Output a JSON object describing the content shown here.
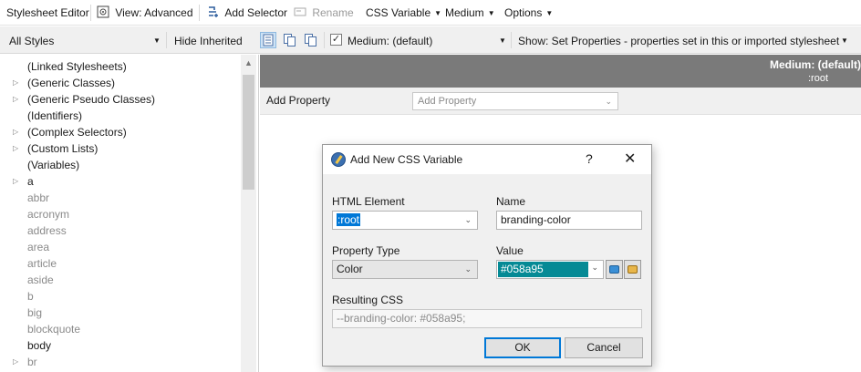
{
  "toolbar": {
    "title": "Stylesheet Editor",
    "view": "View: Advanced",
    "add_selector": "Add Selector",
    "rename": "Rename",
    "css_variable": "CSS Variable",
    "medium": "Medium",
    "options": "Options"
  },
  "filterbar": {
    "styles_select": "All Styles",
    "hide_inherited": "Hide Inherited",
    "medium_checked": true,
    "medium_select": "Medium: (default)",
    "show_select": "Show: Set Properties - properties set in this or imported stylesheet"
  },
  "tree": {
    "items": [
      {
        "label": "(Linked Stylesheets)",
        "expandable": false,
        "style": "normal"
      },
      {
        "label": "(Generic Classes)",
        "expandable": true,
        "style": "normal"
      },
      {
        "label": "(Generic Pseudo Classes)",
        "expandable": true,
        "style": "normal"
      },
      {
        "label": "(Identifiers)",
        "expandable": false,
        "style": "normal"
      },
      {
        "label": "(Complex Selectors)",
        "expandable": true,
        "style": "normal"
      },
      {
        "label": "(Custom Lists)",
        "expandable": true,
        "style": "normal"
      },
      {
        "label": "(Variables)",
        "expandable": false,
        "style": "normal"
      },
      {
        "label": "a",
        "expandable": true,
        "style": "normal"
      },
      {
        "label": "abbr",
        "expandable": false,
        "style": "grey"
      },
      {
        "label": "acronym",
        "expandable": false,
        "style": "grey"
      },
      {
        "label": "address",
        "expandable": false,
        "style": "grey"
      },
      {
        "label": "area",
        "expandable": false,
        "style": "grey"
      },
      {
        "label": "article",
        "expandable": false,
        "style": "grey"
      },
      {
        "label": "aside",
        "expandable": false,
        "style": "grey"
      },
      {
        "label": "b",
        "expandable": false,
        "style": "grey"
      },
      {
        "label": "big",
        "expandable": false,
        "style": "grey"
      },
      {
        "label": "blockquote",
        "expandable": false,
        "style": "grey"
      },
      {
        "label": "body",
        "expandable": false,
        "style": "normal"
      },
      {
        "label": "br",
        "expandable": true,
        "style": "grey"
      }
    ]
  },
  "panel": {
    "medium_title": "Medium: (default)",
    "selector": ":root",
    "add_property_label": "Add Property",
    "add_property_placeholder": "Add Property"
  },
  "dialog": {
    "title": "Add New CSS Variable",
    "help": "?",
    "html_element_label": "HTML Element",
    "html_element_value": ":root",
    "name_label": "Name",
    "name_value": "branding-color",
    "property_type_label": "Property Type",
    "property_type_value": "Color",
    "value_label": "Value",
    "value_value": "#058a95",
    "value_color": "#058a95",
    "resulting_label": "Resulting CSS",
    "resulting_value": "--branding-color: #058a95;",
    "ok": "OK",
    "cancel": "Cancel"
  },
  "colors": {
    "accent": "#0078d7",
    "header_bg": "#7a7a7a"
  }
}
